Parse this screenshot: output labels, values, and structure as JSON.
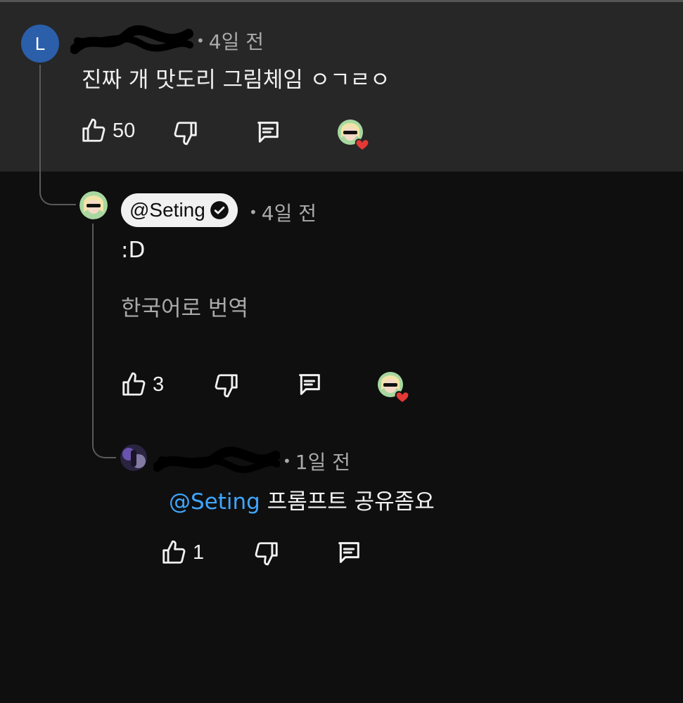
{
  "comment": {
    "avatar_letter": "L",
    "time": "4일 전",
    "text": "진짜 개 맛도리 그림체임 ㅇㄱㄹㅇ",
    "likes": "50",
    "icons": [
      "thumbs-up-icon",
      "thumbs-down-icon",
      "reply-icon",
      "creator-heart-icon"
    ]
  },
  "reply1": {
    "author": "@Seting",
    "time": "4일 전",
    "text": ":D",
    "translate": "한국어로 번역",
    "likes": "3"
  },
  "reply2": {
    "time": "1일 전",
    "mention": "@Seting",
    "text": "프롬프트 공유좀요",
    "likes": "1"
  },
  "colors": {
    "background": "#0f0f0f",
    "highlight": "#272727",
    "mention": "#3ea6ff",
    "heart": "#e53935",
    "avatar_letter_bg": "#2b5faa"
  }
}
